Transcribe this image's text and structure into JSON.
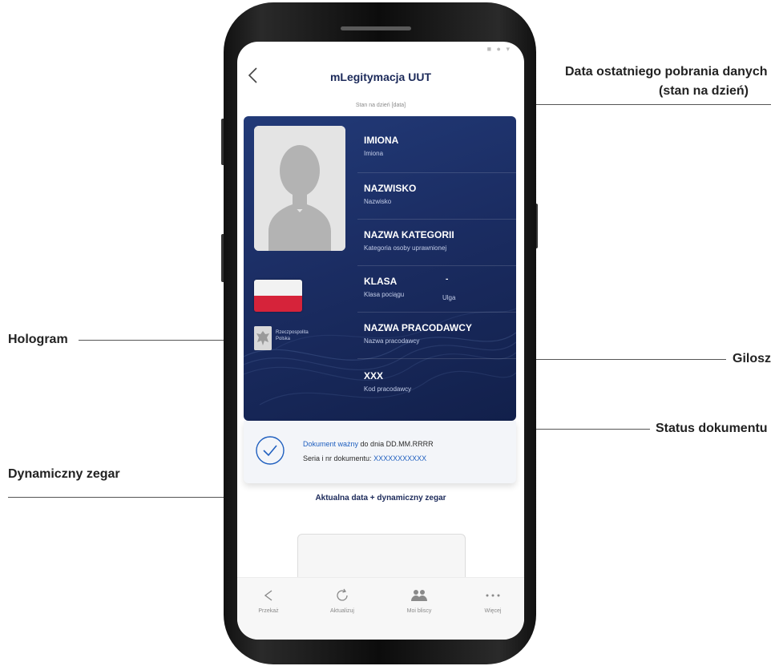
{
  "callouts": {
    "data_line1": "Data ostatniego pobrania danych",
    "data_line2": "(stan na dzień)",
    "hologram": "Hologram",
    "gilosz": "Gilosz",
    "status": "Status dokumentu",
    "zegar": "Dynamiczny zegar"
  },
  "app": {
    "title": "mLegitymacja UUT",
    "stan": "Stan na dzień [data]"
  },
  "card": {
    "rp_line1": "Rzeczpospolita",
    "rp_line2": "Polska",
    "fields": [
      {
        "label": "IMIONA",
        "value": "Imiona"
      },
      {
        "label": "NAZWISKO",
        "value": "Nazwisko"
      },
      {
        "label": "NAZWA KATEGORII",
        "value": "Kategoria osoby uprawnionej"
      },
      {
        "label": "KLASA",
        "value": "Klasa pociągu"
      },
      {
        "label": "NAZWA PRACODAWCY",
        "value": "Nazwa pracodawcy"
      },
      {
        "label": "XXX",
        "value": "Kod pracodawcy"
      }
    ],
    "klasa_dash": "-",
    "ulga": "Ulga"
  },
  "status": {
    "valid": "Dokument ważny",
    "until": "do dnia DD.MM.RRRR",
    "series_label": "Seria i nr dokumentu:",
    "series_value": "XXXXXXXXXXX"
  },
  "clock": "Aktualna data + dynamiczny zegar",
  "tabs": [
    {
      "label": "Przekaż",
      "icon": "share-icon"
    },
    {
      "label": "Aktualizuj",
      "icon": "refresh-icon"
    },
    {
      "label": "Moi bliscy",
      "icon": "people-icon"
    },
    {
      "label": "Więcej",
      "icon": "more-icon"
    }
  ],
  "colors": {
    "card": "#1b2d63",
    "accent": "#1f5fbf",
    "flag_red": "#d6233a"
  }
}
